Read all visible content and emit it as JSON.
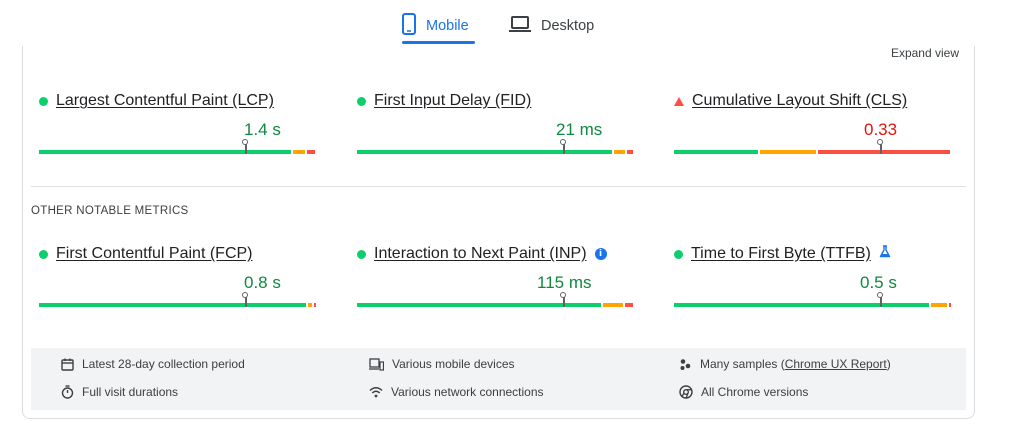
{
  "tabs": {
    "mobile": {
      "label": "Mobile",
      "icon": "smartphone-icon",
      "active": true
    },
    "desktop": {
      "label": "Desktop",
      "icon": "laptop-icon",
      "active": false
    }
  },
  "card": {
    "expand_label": "Expand view",
    "section_title": "OTHER NOTABLE METRICS"
  },
  "core_metrics": [
    {
      "name": "Largest Contentful Paint (LCP)",
      "value": "1.4 s",
      "status": "good",
      "distribution": {
        "good": 0.92,
        "needs_improvement": 0.05,
        "poor": 0.03
      },
      "marker": 0.75
    },
    {
      "name": "First Input Delay (FID)",
      "value": "21 ms",
      "status": "good",
      "distribution": {
        "good": 0.93,
        "needs_improvement": 0.05,
        "poor": 0.02
      },
      "marker": 0.75
    },
    {
      "name": "Cumulative Layout Shift (CLS)",
      "value": "0.33",
      "status": "poor",
      "distribution": {
        "good": 0.31,
        "needs_improvement": 0.21,
        "poor": 0.48
      },
      "marker": 0.75
    }
  ],
  "other_metrics": [
    {
      "name": "First Contentful Paint (FCP)",
      "value": "0.8 s",
      "status": "good",
      "distribution": {
        "good": 0.975,
        "needs_improvement": 0.02,
        "poor": 0.005
      },
      "marker": 0.75,
      "badge": ""
    },
    {
      "name": "Interaction to Next Paint (INP)",
      "value": "115 ms",
      "status": "good",
      "distribution": {
        "good": 0.89,
        "needs_improvement": 0.08,
        "poor": 0.03
      },
      "marker": 0.75,
      "badge": "info-icon"
    },
    {
      "name": "Time to First Byte (TTFB)",
      "value": "0.5 s",
      "status": "good",
      "distribution": {
        "good": 0.93,
        "needs_improvement": 0.065,
        "poor": 0.005
      },
      "marker": 0.75,
      "badge": "flask-icon"
    }
  ],
  "footer": {
    "collection_period": "Latest 28-day collection period",
    "devices": "Various mobile devices",
    "samples_prefix": "Many samples (",
    "samples_link": "Chrome UX Report",
    "samples_suffix": ")",
    "durations": "Full visit durations",
    "network": "Various network connections",
    "chrome_versions": "All Chrome versions"
  },
  "colors": {
    "accent": "#1a73e8",
    "good": "#0cce6b",
    "needs_improvement": "#ffa400",
    "poor": "#ff4e42",
    "good_text": "#0d8a3e",
    "poor_text": "#e8120b"
  }
}
